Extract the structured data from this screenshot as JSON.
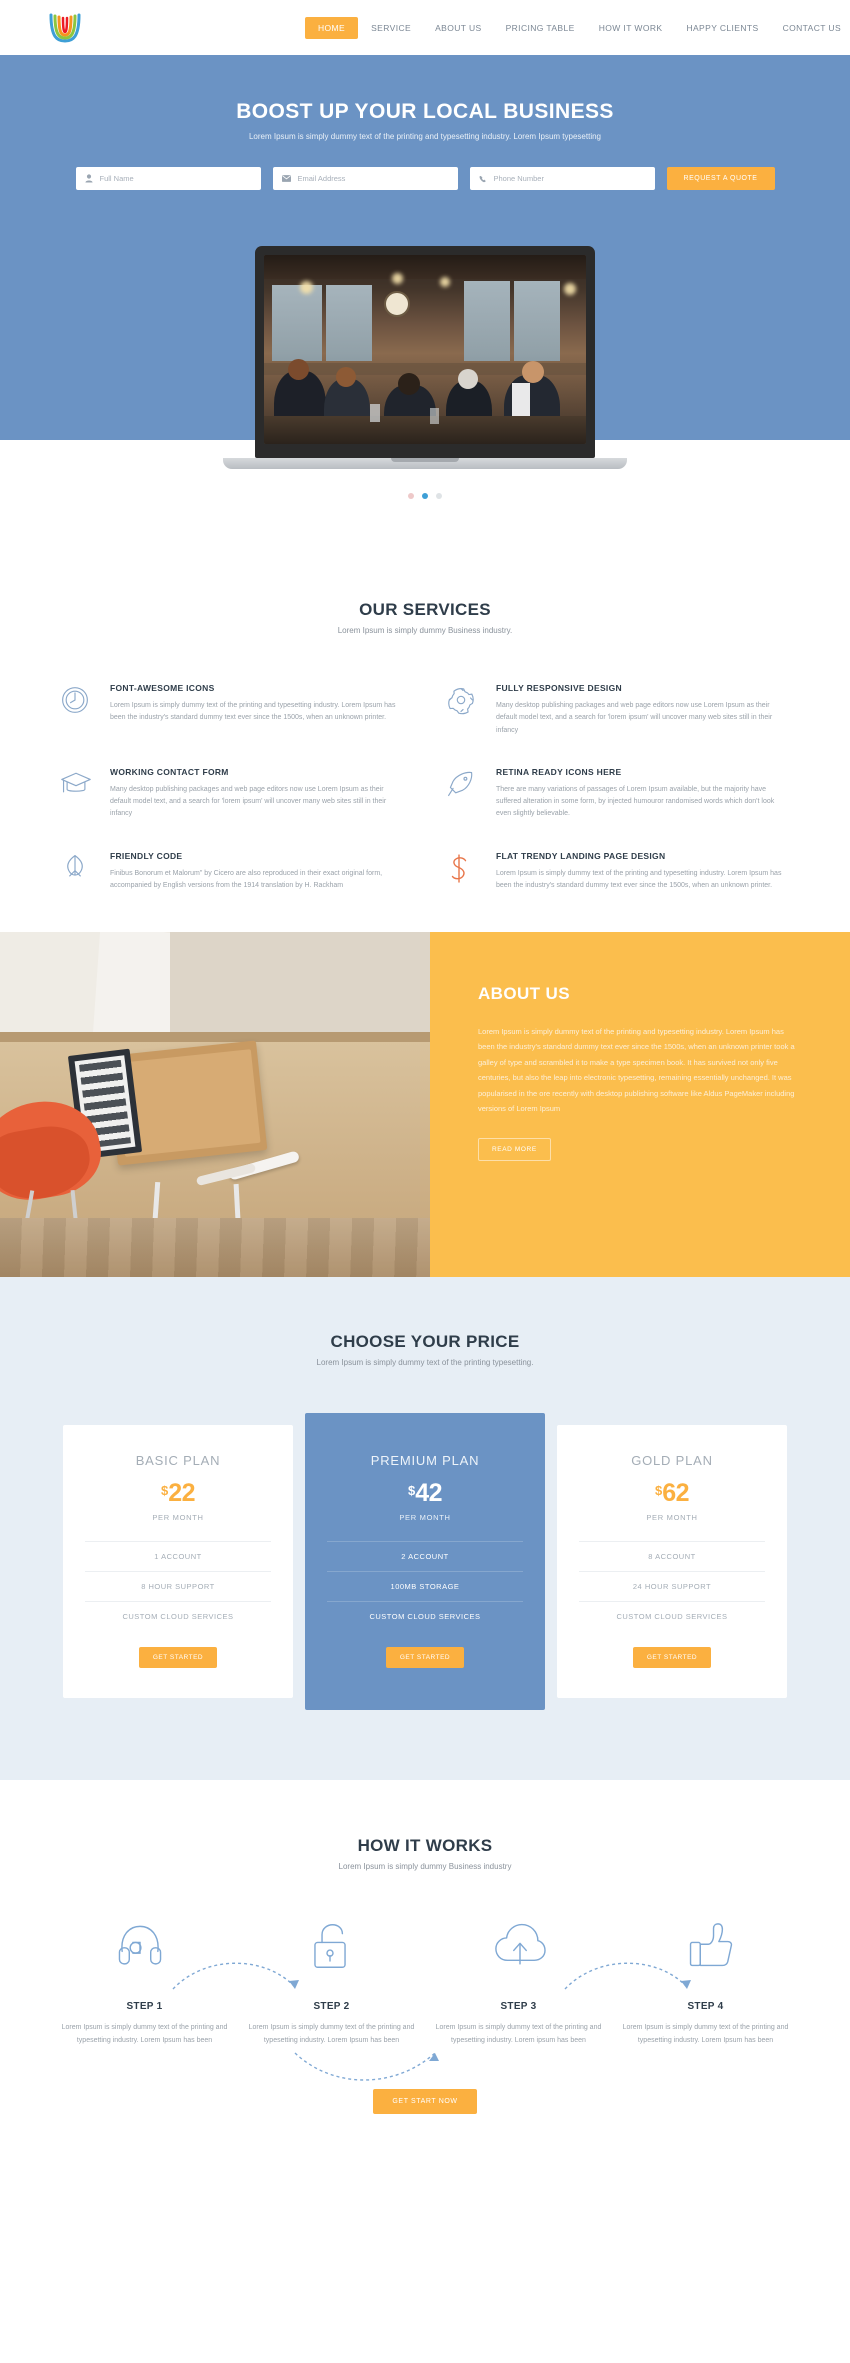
{
  "theme": {
    "accent_orange": "#fbb040",
    "accent_blue": "#6b93c4",
    "about_bg": "#fbbe4d",
    "pricing_bg": "#e7eef5",
    "heading_color": "#2f3d4a",
    "body_text": "#9aa2aa"
  },
  "header": {
    "logo_name": "rainbow-arc-logo",
    "nav": [
      {
        "label": "HOME",
        "active": true
      },
      {
        "label": "SERVICE",
        "active": false
      },
      {
        "label": "ABOUT US",
        "active": false
      },
      {
        "label": "PRICING TABLE",
        "active": false
      },
      {
        "label": "HOW IT WORK",
        "active": false
      },
      {
        "label": "HAPPY CLIENTS",
        "active": false
      },
      {
        "label": "CONTACT US",
        "active": false
      }
    ]
  },
  "hero": {
    "title": "BOOST UP YOUR LOCAL BUSINESS",
    "subtitle": "Lorem Ipsum is simply dummy text of the printing and typesetting industry. Lorem Ipsum typesetting",
    "fields": [
      {
        "icon": "user-icon",
        "placeholder": "Full Name",
        "value": ""
      },
      {
        "icon": "envelope-icon",
        "placeholder": "Email Address",
        "value": ""
      },
      {
        "icon": "phone-icon",
        "placeholder": "Phone Number",
        "value": ""
      }
    ],
    "cta_label": "REQUEST A QUOTE",
    "slider_dots": [
      {
        "state": "inactive-pink"
      },
      {
        "state": "active"
      },
      {
        "state": "inactive-grey"
      }
    ]
  },
  "services": {
    "title": "OUR SERVICES",
    "subtitle": "Lorem Ipsum is simply dummy Business industry.",
    "items": [
      {
        "icon": "clock-icon",
        "icon_color": "#6b93c4",
        "title": "FONT-AWESOME ICONS",
        "text": "Lorem Ipsum is simply dummy text of the printing and typesetting industry. Lorem Ipsum has been the industry's standard dummy text ever since the 1500s, when an unknown printer."
      },
      {
        "icon": "gear-icon",
        "icon_color": "#6b93c4",
        "title": "FULLY RESPONSIVE DESIGN",
        "text": "Many desktop publishing packages and web page editors now use Lorem Ipsum as their default model text, and a search for 'lorem ipsum' will uncover many web sites still in their infancy"
      },
      {
        "icon": "graduation-cap-icon",
        "icon_color": "#6b93c4",
        "title": "WORKING CONTACT FORM",
        "text": "Many desktop publishing packages and web page editors now use Lorem Ipsum as their default model text, and a search for 'lorem ipsum' will uncover many web sites still in their infancy"
      },
      {
        "icon": "rocket-icon",
        "icon_color": "#6b93c4",
        "title": "RETINA READY ICONS HERE",
        "text": "There are many variations of passages of Lorem Ipsum available, but the majority have suffered alteration in some form, by injected humouror randomised words which don't look even slightly believable."
      },
      {
        "icon": "peace-leaf-icon",
        "icon_color": "#6b93c4",
        "title": "FRIENDLY CODE",
        "text": "Finibus Bonorum et Malorum\" by Cicero are also reproduced in their exact original form, accompanied by English versions from the 1914 translation by H. Rackham"
      },
      {
        "icon": "dollar-sign-icon",
        "icon_color": "#e8764a",
        "title": "FLAT TRENDY LANDING PAGE DESIGN",
        "text": "Lorem Ipsum is simply dummy text of the printing and typesetting industry. Lorem Ipsum has been the industry's standard dummy text ever since the 1500s, when an unknown printer."
      }
    ]
  },
  "about": {
    "image_name": "desk-with-notebook-and-orange-chair-photo",
    "title": "ABOUT US",
    "text": "Lorem Ipsum is simply dummy text of the printing and typesetting industry. Lorem Ipsum has been the industry's standard dummy text ever since the 1500s, when an unknown printer took a galley of type and scrambled it to make a type specimen book. It has survived not only five centuries, but also the leap into electronic typesetting, remaining essentially unchanged. It was popularised in the ore recently with desktop publishing software like Aldus PageMaker including versions of Lorem Ipsum",
    "button_label": "READ MORE"
  },
  "pricing": {
    "title": "CHOOSE YOUR PRICE",
    "subtitle": "Lorem Ipsum is simply dummy text of the printing typesetting.",
    "plans": [
      {
        "name": "BASIC PLAN",
        "currency": "$",
        "price": "22",
        "period": "PER MONTH",
        "features": [
          "1 ACCOUNT",
          "8 HOUR SUPPORT",
          "CUSTOM CLOUD SERVICES"
        ],
        "button_label": "GET STARTED",
        "featured": false
      },
      {
        "name": "PREMIUM PLAN",
        "currency": "$",
        "price": "42",
        "period": "PER MONTH",
        "features": [
          "2 ACCOUNT",
          "100MB STORAGE",
          "CUSTOM CLOUD SERVICES"
        ],
        "button_label": "GET STARTED",
        "featured": true
      },
      {
        "name": "GOLD PLAN",
        "currency": "$",
        "price": "62",
        "period": "PER MONTH",
        "features": [
          "8 ACCOUNT",
          "24 HOUR SUPPORT",
          "CUSTOM CLOUD SERVICES"
        ],
        "button_label": "GET STARTED",
        "featured": false
      }
    ]
  },
  "how_it_works": {
    "title": "HOW IT WORKS",
    "subtitle": "Lorem Ipsum is simply dummy Business industry",
    "steps": [
      {
        "icon": "headphones-icon",
        "title": "STEP 1",
        "text": "Lorem Ipsum is simply dummy text of the printing and typesetting industry. Lorem Ipsum has been"
      },
      {
        "icon": "unlock-icon",
        "title": "STEP 2",
        "text": "Lorem Ipsum is simply dummy text of the printing and typesetting industry. Lorem Ipsum has been"
      },
      {
        "icon": "cloud-upload-icon",
        "title": "STEP 3",
        "text": "Lorem Ipsum is simply dummy text of the printing and typesetting industry. Lorem ipsum has been"
      },
      {
        "icon": "thumbs-up-icon",
        "title": "STEP 4",
        "text": "Lorem Ipsum is simply dummy text of the printing and typesetting industry. Lorem Ipsum has been"
      }
    ],
    "cta_label": "GET START NOW"
  }
}
